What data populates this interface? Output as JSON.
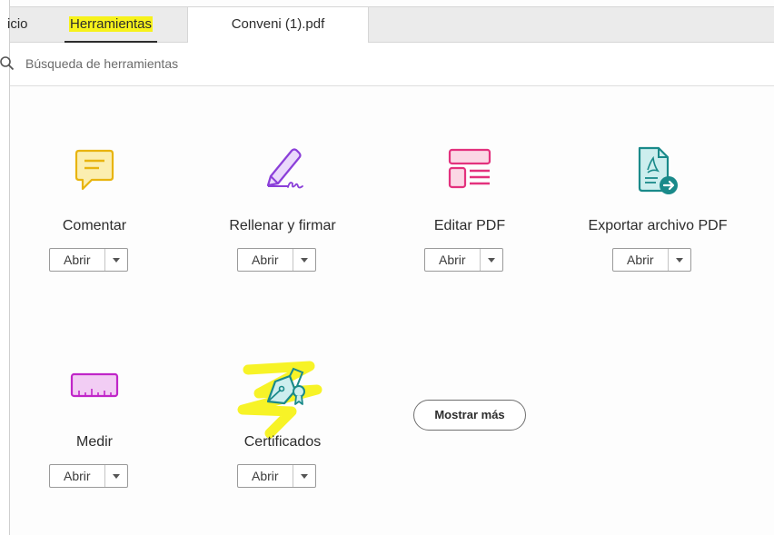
{
  "tabs": {
    "home": "icio",
    "tools": "Herramientas",
    "document": "Conveni (1).pdf"
  },
  "search": {
    "placeholder": "Búsqueda de herramientas"
  },
  "tools": [
    {
      "name": "Comentar",
      "button": "Abrir",
      "icon": "comment-icon"
    },
    {
      "name": "Rellenar y firmar",
      "button": "Abrir",
      "icon": "fill-sign-icon"
    },
    {
      "name": "Editar PDF",
      "button": "Abrir",
      "icon": "edit-pdf-icon"
    },
    {
      "name": "Exportar archivo PDF",
      "button": "Abrir",
      "icon": "export-pdf-icon"
    },
    {
      "name": "Medir",
      "button": "Abrir",
      "icon": "measure-icon"
    },
    {
      "name": "Certificados",
      "button": "Abrir",
      "icon": "certificates-icon"
    }
  ],
  "more_button": "Mostrar más",
  "colors": {
    "highlight": "#f7f21b",
    "comment": "#e8b40f",
    "fill_sign": "#8b3fd9",
    "edit_pdf": "#e3317d",
    "export_pdf": "#1a8a8a",
    "measure": "#c026c8",
    "certificates": "#1a8a8a"
  }
}
